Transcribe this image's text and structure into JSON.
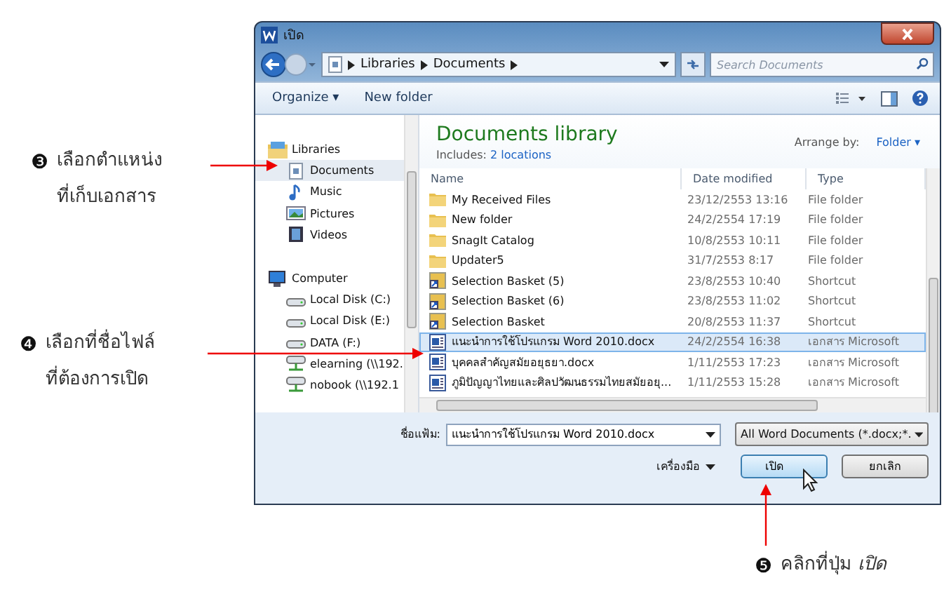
{
  "annotations": [
    {
      "number": "❸",
      "lines": [
        "เลือกตำแหน่ง",
        "ที่เก็บเอกสาร"
      ]
    },
    {
      "number": "❹",
      "lines": [
        "เลือกที่ชื่อไฟล์",
        "ที่ต้องการเปิด"
      ]
    },
    {
      "number": "❺",
      "lines": [
        "คลิกที่ปุ่ม *เปิด*"
      ]
    }
  ],
  "window": {
    "title": "เปิด"
  },
  "address": {
    "crumbs": [
      "Libraries",
      "Documents"
    ]
  },
  "search": {
    "placeholder": "Search Documents"
  },
  "toolbar": [
    "Organize ▾",
    "New folder"
  ],
  "sidebar": {
    "items": [
      {
        "label": "Libraries",
        "kind": "library",
        "selected": false,
        "children": [
          {
            "label": "Documents",
            "kind": "doc-lib",
            "selected": true
          },
          {
            "label": "Music",
            "kind": "music",
            "selected": false
          },
          {
            "label": "Pictures",
            "kind": "pictures",
            "selected": false
          },
          {
            "label": "Videos",
            "kind": "videos",
            "selected": false
          }
        ]
      },
      {
        "label": "Computer",
        "kind": "computer",
        "selected": false,
        "children": [
          {
            "label": "Local Disk (C:)",
            "kind": "disk",
            "selected": false
          },
          {
            "label": "Local Disk (E:)",
            "kind": "disk",
            "selected": false
          },
          {
            "label": "DATA (F:)",
            "kind": "disk",
            "selected": false
          },
          {
            "label": "elearning (\\\\192.",
            "kind": "network",
            "selected": false
          },
          {
            "label": "nobook (\\\\192.1",
            "kind": "network",
            "selected": false
          }
        ]
      }
    ]
  },
  "library": {
    "title": "Documents library",
    "includes_label": "Includes:",
    "includes_link": "2 locations",
    "arrange_label": "Arrange by:",
    "arrange_value": "Folder ▾"
  },
  "table": {
    "columns": [
      "Name",
      "Date modified",
      "Type"
    ],
    "rows": [
      {
        "name": "My Received Files",
        "date": "23/12/2553 13:16",
        "type": "File folder",
        "kind": "folder",
        "selected": false
      },
      {
        "name": "New folder",
        "date": "24/2/2554 17:19",
        "type": "File folder",
        "kind": "folder",
        "selected": false
      },
      {
        "name": "SnagIt Catalog",
        "date": "10/8/2553 10:11",
        "type": "File folder",
        "kind": "folder",
        "selected": false
      },
      {
        "name": "Updater5",
        "date": "31/7/2553 8:17",
        "type": "File folder",
        "kind": "folder",
        "selected": false
      },
      {
        "name": "Selection Basket (5)",
        "date": "23/8/2553 10:40",
        "type": "Shortcut",
        "kind": "shortcut",
        "selected": false
      },
      {
        "name": "Selection Basket (6)",
        "date": "23/8/2553 11:02",
        "type": "Shortcut",
        "kind": "shortcut",
        "selected": false
      },
      {
        "name": "Selection Basket",
        "date": "20/8/2553 11:37",
        "type": "Shortcut",
        "kind": "shortcut",
        "selected": false
      },
      {
        "name": "แนะนำการใช้โปรแกรม Word 2010.docx",
        "date": "24/2/2554 16:38",
        "type": "เอกสาร Microsoft",
        "kind": "document",
        "selected": true
      },
      {
        "name": "บุคคลสำคัญสมัยอยุธยา.docx",
        "date": "1/11/2553 17:23",
        "type": "เอกสาร Microsoft",
        "kind": "document",
        "selected": false
      },
      {
        "name": "ภูมิปัญญาไทยและศิลปวัฒนธรรมไทยสมัยอยุ...",
        "date": "1/11/2553 15:28",
        "type": "เอกสาร Microsoft",
        "kind": "document",
        "selected": false
      }
    ]
  },
  "filename": {
    "label": "ชื่อแฟ้ม:",
    "value": "แนะนำการใช้โปรแกรม Word 2010.docx"
  },
  "filter": {
    "value": "All Word Documents (*.docx;*."
  },
  "tools": {
    "label": "เครื่องมือ"
  },
  "buttons": {
    "open": "เปิด",
    "cancel": "ยกเลิก"
  }
}
